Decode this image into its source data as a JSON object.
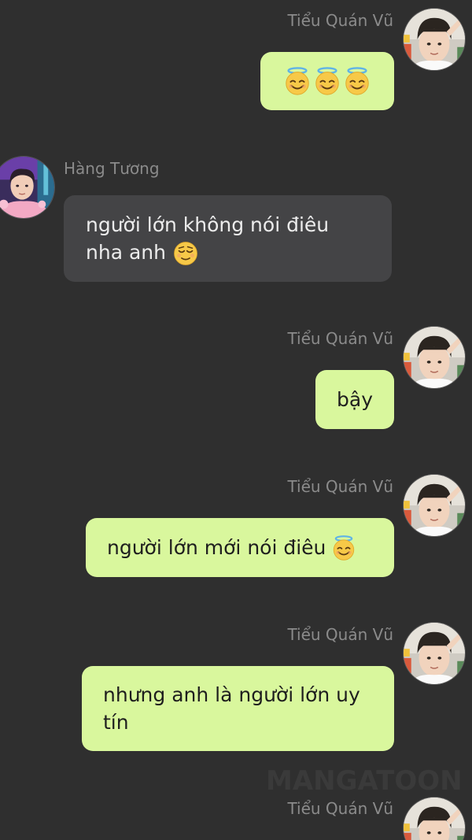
{
  "watermark": "MANGATOON",
  "messages": [
    {
      "sender": "Tiểu Quán Vũ",
      "side": "right",
      "text": "",
      "emojis": [
        "halo-smile-icon",
        "halo-smile-icon",
        "halo-smile-icon"
      ]
    },
    {
      "sender": "Hàng Tương",
      "side": "left",
      "line1": "người lớn không nói điêu",
      "line2": "nha anh",
      "emojis": [
        "relieved-face-icon"
      ]
    },
    {
      "sender": "Tiểu Quán Vũ",
      "side": "right",
      "text": "bậy"
    },
    {
      "sender": "Tiểu Quán Vũ",
      "side": "right",
      "text": "người lớn mới nói điêu",
      "emojis": [
        "halo-smile-icon"
      ]
    },
    {
      "sender": "Tiểu Quán Vũ",
      "side": "right",
      "line1": "nhưng anh là người lớn uy",
      "line2": "tín"
    },
    {
      "sender": "Tiểu Quán Vũ",
      "side": "right",
      "text": ""
    }
  ],
  "colors": {
    "background": "#2f2f2f",
    "my_bubble": "#d9f79d",
    "their_bubble": "#444446",
    "name_text": "#8b8b8b"
  }
}
